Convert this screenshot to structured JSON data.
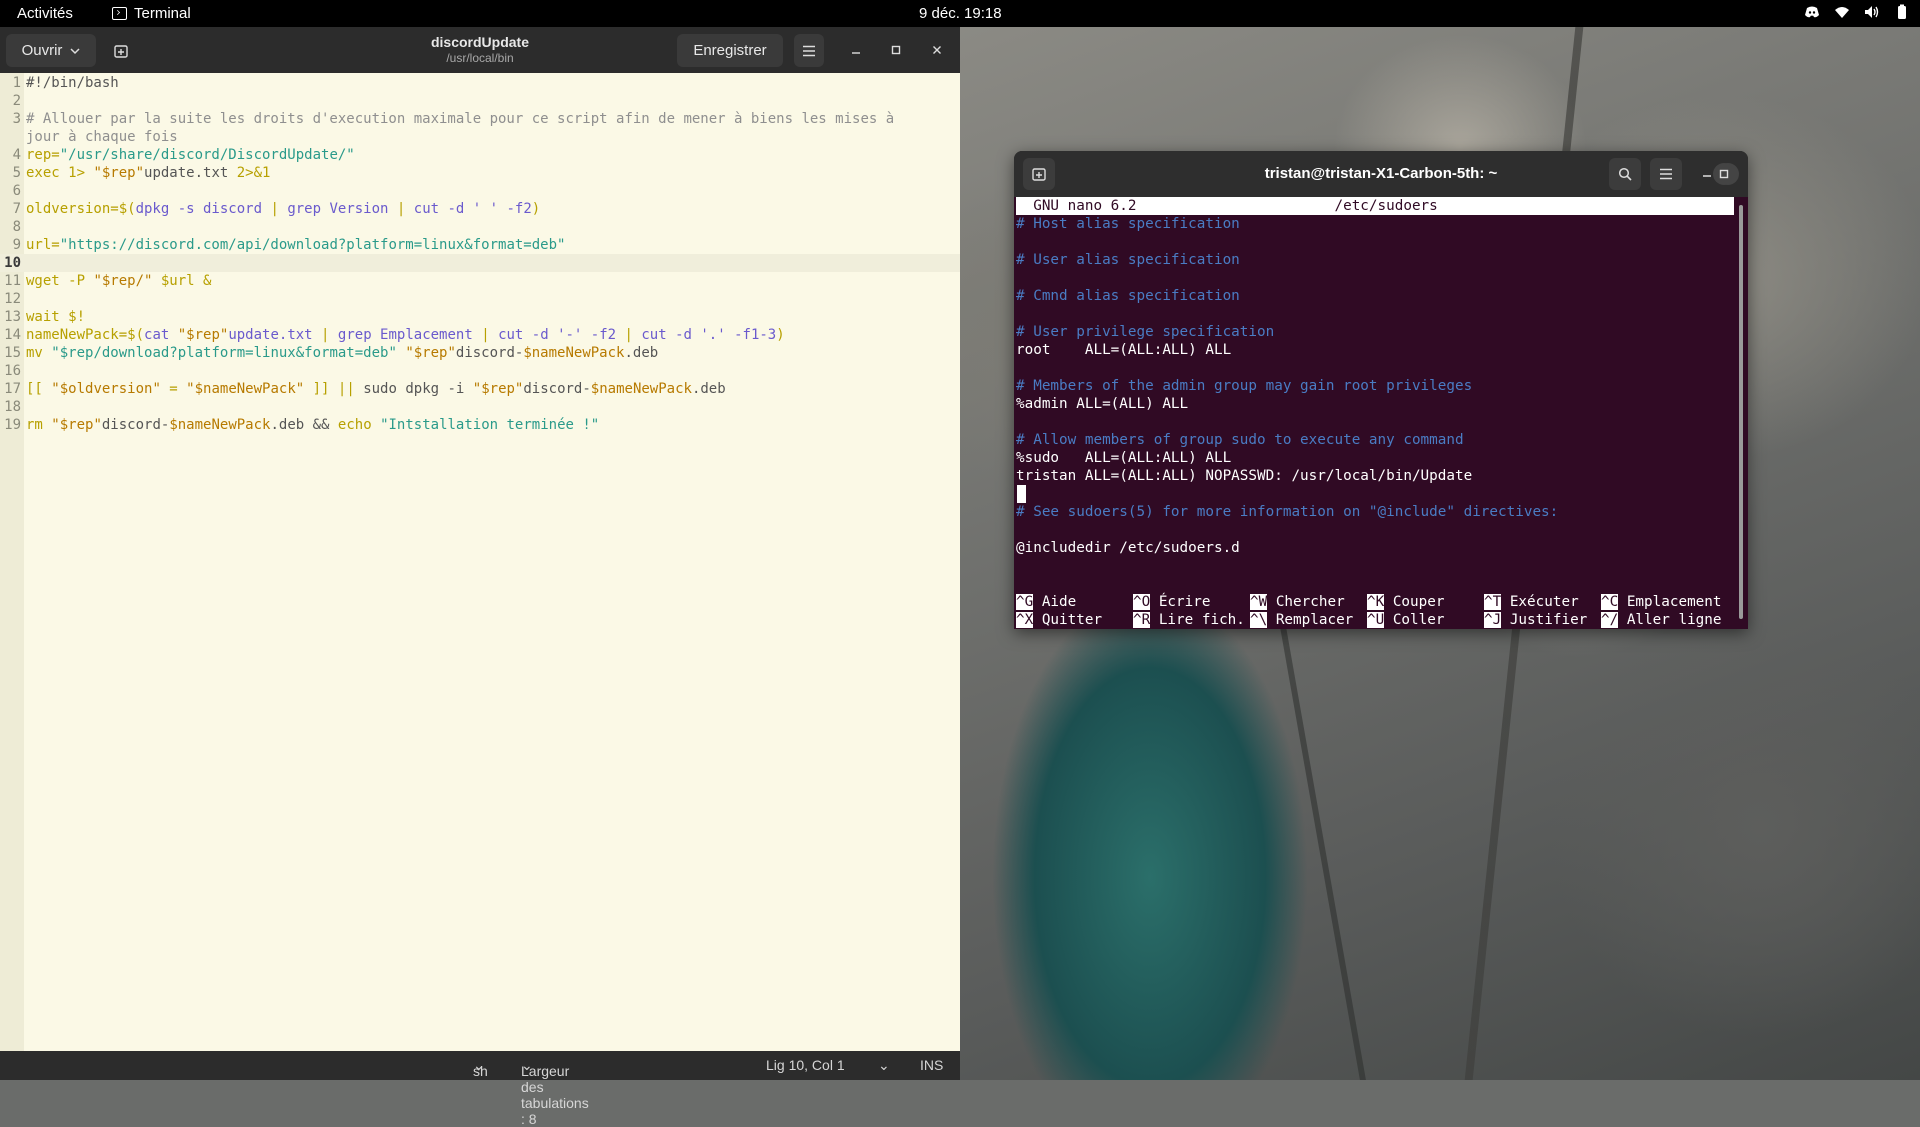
{
  "topbar": {
    "activities": "Activités",
    "app_name": "Terminal",
    "clock": "9 déc.  19:18"
  },
  "gedit": {
    "open_label": "Ouvrir",
    "title": "discordUpdate",
    "subtitle": "/usr/local/bin",
    "save_label": "Enregistrer",
    "current_line": 10,
    "lines": [
      [
        {
          "t": "#!/bin/bash",
          "c": "pl"
        }
      ],
      [],
      [
        {
          "t": "# Allouer par la suite les droits d'execution maximale pour ce script afin de mener à biens les mises à",
          "c": "com"
        }
      ],
      [
        {
          "t": "jour à chaque fois",
          "c": "com"
        }
      ],
      [
        {
          "t": "rep=",
          "c": "kw"
        },
        {
          "t": "\"/usr/share/discord/DiscordUpdate/\"",
          "c": "str"
        }
      ],
      [
        {
          "t": "exec 1> ",
          "c": "kw"
        },
        {
          "t": "\"$rep\"",
          "c": "var"
        },
        {
          "t": "update.txt ",
          "c": "pl"
        },
        {
          "t": "2>&1",
          "c": "kw"
        }
      ],
      [],
      [
        {
          "t": "oldversion=$(",
          "c": "kw"
        },
        {
          "t": "dpkg -s discord",
          "c": "cmd"
        },
        {
          "t": " | ",
          "c": "kw"
        },
        {
          "t": "grep Version",
          "c": "cmd"
        },
        {
          "t": " | ",
          "c": "kw"
        },
        {
          "t": "cut -d ' ' -f2",
          "c": "cmd"
        },
        {
          "t": ")",
          "c": "kw"
        }
      ],
      [],
      [
        {
          "t": "url=",
          "c": "kw"
        },
        {
          "t": "\"https://discord.com/api/download?platform=linux&format=deb\"",
          "c": "str"
        }
      ],
      [],
      [
        {
          "t": "wget -P ",
          "c": "kw"
        },
        {
          "t": "\"$rep/\"",
          "c": "var"
        },
        {
          "t": " $url &",
          "c": "kw"
        }
      ],
      [],
      [
        {
          "t": "wait $!",
          "c": "kw"
        }
      ],
      [
        {
          "t": "nameNewPack=$(",
          "c": "kw"
        },
        {
          "t": "cat ",
          "c": "cmd"
        },
        {
          "t": "\"$rep\"",
          "c": "var"
        },
        {
          "t": "update.txt",
          "c": "cmd"
        },
        {
          "t": " | ",
          "c": "kw"
        },
        {
          "t": "grep Emplacement",
          "c": "cmd"
        },
        {
          "t": " | ",
          "c": "kw"
        },
        {
          "t": "cut -d '-' -f2",
          "c": "cmd"
        },
        {
          "t": " | ",
          "c": "kw"
        },
        {
          "t": "cut -d '.' -f1-3",
          "c": "cmd"
        },
        {
          "t": ")",
          "c": "kw"
        }
      ],
      [
        {
          "t": "mv ",
          "c": "kw"
        },
        {
          "t": "\"$rep/download?platform=linux&format=deb\"",
          "c": "str"
        },
        {
          "t": " ",
          "c": "pl"
        },
        {
          "t": "\"$rep\"",
          "c": "var"
        },
        {
          "t": "discord-",
          "c": "pl"
        },
        {
          "t": "$nameNewPack",
          "c": "var"
        },
        {
          "t": ".deb",
          "c": "pl"
        }
      ],
      [],
      [
        {
          "t": "[[ ",
          "c": "kw"
        },
        {
          "t": "\"$oldversion\"",
          "c": "var"
        },
        {
          "t": " = ",
          "c": "kw"
        },
        {
          "t": "\"$nameNewPack\"",
          "c": "var"
        },
        {
          "t": " ]] || ",
          "c": "kw"
        },
        {
          "t": "sudo dpkg -i ",
          "c": "pl"
        },
        {
          "t": "\"$rep\"",
          "c": "var"
        },
        {
          "t": "discord-",
          "c": "pl"
        },
        {
          "t": "$nameNewPack",
          "c": "var"
        },
        {
          "t": ".deb",
          "c": "pl"
        }
      ],
      [],
      [
        {
          "t": "rm ",
          "c": "kw"
        },
        {
          "t": "\"$rep\"",
          "c": "var"
        },
        {
          "t": "discord-",
          "c": "pl"
        },
        {
          "t": "$nameNewPack",
          "c": "var"
        },
        {
          "t": ".deb && ",
          "c": "pl"
        },
        {
          "t": "echo ",
          "c": "kw"
        },
        {
          "t": "\"Intstallation terminée !\"",
          "c": "str"
        }
      ]
    ],
    "line_numbers": [
      "1",
      "2",
      "3",
      "",
      "4",
      "5",
      "6",
      "7",
      "8",
      "9",
      "10",
      "11",
      "12",
      "13",
      "14",
      "15",
      "16",
      "17",
      "18",
      "19"
    ],
    "status": {
      "language": "sh",
      "tab_width": "Largeur des tabulations : 8",
      "position": "Lig 10, Col 1",
      "mode": "INS"
    }
  },
  "terminal": {
    "title": "tristan@tristan-X1-Carbon-5th: ~",
    "nano_header": "  GNU nano 6.2                       /etc/sudoers",
    "lines": [
      {
        "t": "# Host alias specification",
        "c": "com"
      },
      {
        "t": "",
        "c": ""
      },
      {
        "t": "# User alias specification",
        "c": "com"
      },
      {
        "t": "",
        "c": ""
      },
      {
        "t": "# Cmnd alias specification",
        "c": "com"
      },
      {
        "t": "",
        "c": ""
      },
      {
        "t": "# User privilege specification",
        "c": "com"
      },
      {
        "t": "root    ALL=(ALL:ALL) ALL",
        "c": ""
      },
      {
        "t": "",
        "c": ""
      },
      {
        "t": "# Members of the admin group may gain root privileges",
        "c": "com"
      },
      {
        "t": "%admin ALL=(ALL) ALL",
        "c": ""
      },
      {
        "t": "",
        "c": ""
      },
      {
        "t": "# Allow members of group sudo to execute any command",
        "c": "com"
      },
      {
        "t": "%sudo   ALL=(ALL:ALL) ALL",
        "c": ""
      },
      {
        "t": "tristan ALL=(ALL:ALL) NOPASSWD: /usr/local/bin/Update",
        "c": ""
      },
      {
        "t": "",
        "c": ""
      },
      {
        "t": "# See sudoers(5) for more information on \"@include\" directives:",
        "c": "com"
      },
      {
        "t": "",
        "c": ""
      },
      {
        "t": "@includedir /etc/sudoers.d",
        "c": ""
      }
    ],
    "shortcuts_row1": [
      {
        "k": "^G",
        "l": "Aide"
      },
      {
        "k": "^O",
        "l": "Écrire"
      },
      {
        "k": "^W",
        "l": "Chercher"
      },
      {
        "k": "^K",
        "l": "Couper"
      },
      {
        "k": "^T",
        "l": "Exécuter"
      },
      {
        "k": "^C",
        "l": "Emplacement"
      }
    ],
    "shortcuts_row2": [
      {
        "k": "^X",
        "l": "Quitter"
      },
      {
        "k": "^R",
        "l": "Lire fich."
      },
      {
        "k": "^\\",
        "l": "Remplacer"
      },
      {
        "k": "^U",
        "l": "Coller"
      },
      {
        "k": "^J",
        "l": "Justifier"
      },
      {
        "k": "^/",
        "l": "Aller ligne"
      }
    ]
  },
  "icons": {
    "tray": [
      "discord-icon",
      "wifi-icon",
      "volume-icon",
      "battery-icon"
    ]
  }
}
